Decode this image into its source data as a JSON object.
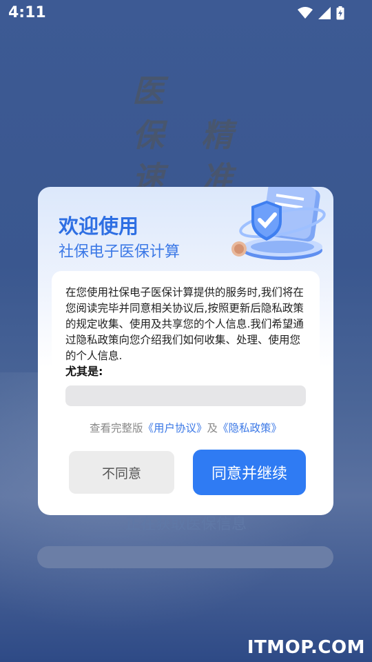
{
  "status": {
    "time": "4:11"
  },
  "background": {
    "slogan": [
      "医",
      "保",
      "精",
      "速",
      "准"
    ],
    "loading_text": "正在获取医保信息",
    "watermark": "ITMOP.COM"
  },
  "dialog": {
    "title": "欢迎使用",
    "subtitle": "社保电子医保计算",
    "body": "在您使用社保电子医保计算提供的服务时,我们将在您阅读完毕并同意相关协议后,按照更新后隐私政策的规定收集、使用及共享您的个人信息.我们希望通过隐私政策向您介绍我们如何收集、处理、使用您的个人信息.",
    "emphasis": "尤其是:",
    "links": {
      "prefix": "查看完整版",
      "user_agreement": "《用户协议》",
      "and": "及",
      "privacy_policy": "《隐私政策》"
    },
    "buttons": {
      "disagree": "不同意",
      "agree": "同意并继续"
    }
  },
  "colors": {
    "accent": "#2f7bf3",
    "title": "#2e6fe3"
  },
  "icons": [
    "wifi-icon",
    "signal-icon",
    "battery-icon",
    "shield-check-icon"
  ]
}
